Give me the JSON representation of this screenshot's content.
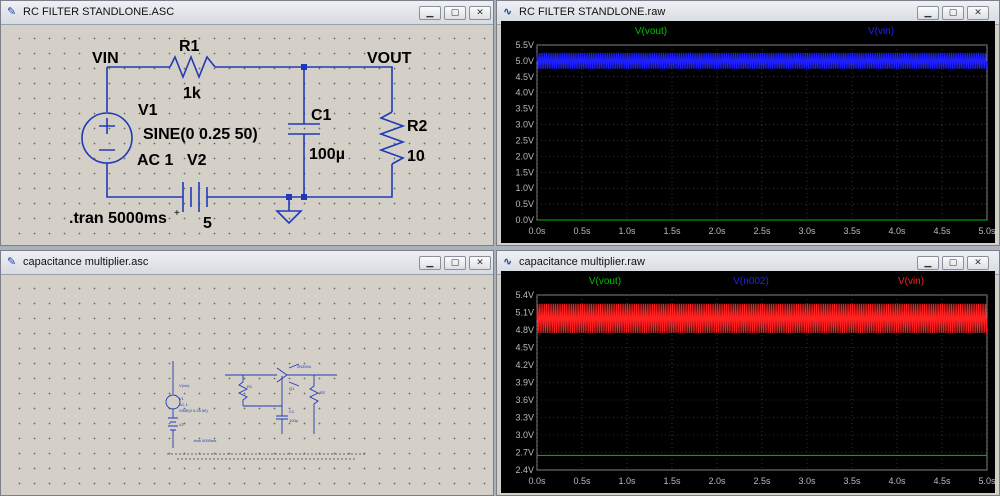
{
  "windows": {
    "rc_schematic": {
      "title": "RC FILTER STANDLONE.ASC",
      "labels": {
        "vin_net": "VIN",
        "vout_net": "VOUT",
        "r1_name": "R1",
        "r1_value": "1k",
        "v1_name": "V1",
        "v1_value": "SINE(0 0.25 50)",
        "v1_ac": "AC 1",
        "v2_name": "V2",
        "v2_value": "5",
        "c1_name": "C1",
        "c1_value": "100µ",
        "r2_name": "R2",
        "r2_value": "10",
        "tran": ".tran 5000ms"
      }
    },
    "cap_schematic": {
      "title": "capacitance multiplier.asc",
      "labels": {
        "v1_name": "V1",
        "v1_ac": "AC 1",
        "v1_value": "SINE(0 0.25 50)",
        "v2_name": "V2",
        "tran": ".tran 5000ms",
        "r1_name": "R1",
        "c1_name": "C1",
        "c1_value": "100µ",
        "r2_name": "R2",
        "q1_name": "Q1",
        "q1_value": "2N3904",
        "vin_tag": "V(vin)"
      }
    },
    "rc_plot": {
      "title": "RC FILTER STANDLONE.raw",
      "traces": [
        {
          "name": "V(vout)",
          "color": "#00c000"
        },
        {
          "name": "V(vin)",
          "color": "#2020ff"
        }
      ],
      "y_ticks": [
        "5.5V",
        "5.0V",
        "4.5V",
        "4.0V",
        "3.5V",
        "3.0V",
        "2.5V",
        "2.0V",
        "1.5V",
        "1.0V",
        "0.5V",
        "0.0V"
      ],
      "x_ticks": [
        "0.0s",
        "0.5s",
        "1.0s",
        "1.5s",
        "2.0s",
        "2.5s",
        "3.0s",
        "3.5s",
        "4.0s",
        "4.5s",
        "5.0s"
      ]
    },
    "cap_plot": {
      "title": "capacitance multiplier.raw",
      "traces": [
        {
          "name": "V(vout)",
          "color": "#00c000"
        },
        {
          "name": "V(n002)",
          "color": "#2020ff"
        },
        {
          "name": "V(vin)",
          "color": "#ff2020"
        }
      ],
      "y_ticks": [
        "5.4V",
        "5.1V",
        "4.8V",
        "4.5V",
        "4.2V",
        "3.9V",
        "3.6V",
        "3.3V",
        "3.0V",
        "2.7V",
        "2.4V"
      ],
      "x_ticks": [
        "0.0s",
        "0.5s",
        "1.0s",
        "1.5s",
        "2.0s",
        "2.5s",
        "3.0s",
        "3.5s",
        "4.0s",
        "4.5s",
        "5.0s"
      ]
    }
  },
  "chart_data": [
    {
      "type": "line",
      "x": [
        0,
        0.5,
        1.0,
        1.5,
        2.0,
        2.5,
        3.0,
        3.5,
        4.0,
        4.5,
        5.0
      ],
      "xlim": [
        0,
        5
      ],
      "ylim": [
        0,
        5.5
      ],
      "grid": true,
      "series": [
        {
          "name": "V(vout)",
          "color": "#00c000",
          "values": [
            0.0,
            0.0,
            0.0,
            0.0,
            0.0,
            0.0,
            0.0,
            0.0,
            0.0,
            0.0,
            0.0
          ]
        },
        {
          "name": "V(vin)",
          "color": "#2020ff",
          "center": 5.0,
          "amplitude": 0.25,
          "frequency": 50,
          "values": [
            5.0,
            5.0,
            5.0,
            5.0,
            5.0,
            5.0,
            5.0,
            5.0,
            5.0,
            5.0,
            5.0
          ]
        }
      ]
    },
    {
      "type": "line",
      "x": [
        0,
        0.5,
        1.0,
        1.5,
        2.0,
        2.5,
        3.0,
        3.5,
        4.0,
        4.5,
        5.0
      ],
      "xlim": [
        0,
        5
      ],
      "ylim": [
        2.4,
        5.4
      ],
      "grid": true,
      "series": [
        {
          "name": "V(vout)",
          "color": "#00c000",
          "values": [
            2.65,
            2.65,
            2.65,
            2.65,
            2.65,
            2.65,
            2.65,
            2.65,
            2.65,
            2.65,
            2.65
          ]
        },
        {
          "name": "V(n002)",
          "color": "#2020ff",
          "values": []
        },
        {
          "name": "V(vin)",
          "color": "#ff2020",
          "center": 5.0,
          "amplitude": 0.25,
          "frequency": 50,
          "values": [
            5.0,
            5.0,
            5.0,
            5.0,
            5.0,
            5.0,
            5.0,
            5.0,
            5.0,
            5.0,
            5.0
          ]
        }
      ]
    }
  ]
}
